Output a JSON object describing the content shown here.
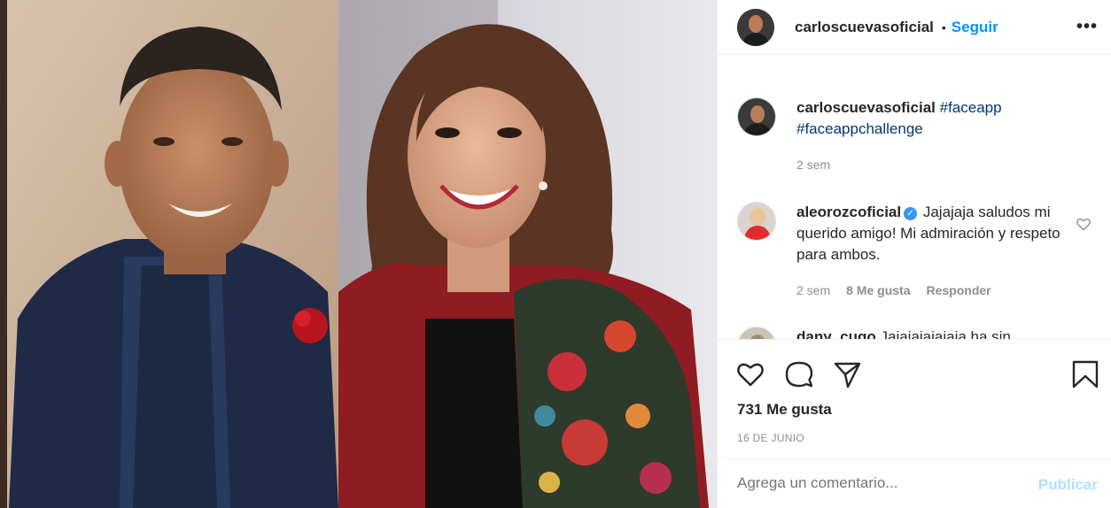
{
  "post": {
    "author": "carloscuevasoficial",
    "follow_label": "Seguir",
    "separator": "•",
    "more_label": "•••",
    "caption_hashtags": [
      "#faceapp",
      "#faceappchallenge"
    ],
    "caption_time": "2 sem"
  },
  "comments": [
    {
      "user": "aleorozcoficial",
      "verified": true,
      "verified_mark": "✓",
      "text": "Jajajaja saludos mi querido amigo! Mi admiración y respeto para ambos.",
      "time": "2 sem",
      "likes": "8 Me gusta",
      "reply_label": "Responder"
    },
    {
      "user": "dany_cugo",
      "text": "Jajajajajajaja ha sin"
    }
  ],
  "actions": {
    "like_icon": "heart-icon",
    "comment_icon": "comment-icon",
    "share_icon": "paper-plane-icon",
    "save_icon": "bookmark-icon",
    "likes_count": "731 Me gusta",
    "date": "16 DE JUNIO"
  },
  "add_comment": {
    "placeholder": "Agrega un comentario...",
    "publish_label": "Publicar"
  },
  "colors": {
    "link_blue": "#0095f6",
    "hashtag": "#00376b",
    "muted": "#8e8e8e",
    "publish_disabled": "#b2dffc",
    "verified": "#3897f0"
  }
}
